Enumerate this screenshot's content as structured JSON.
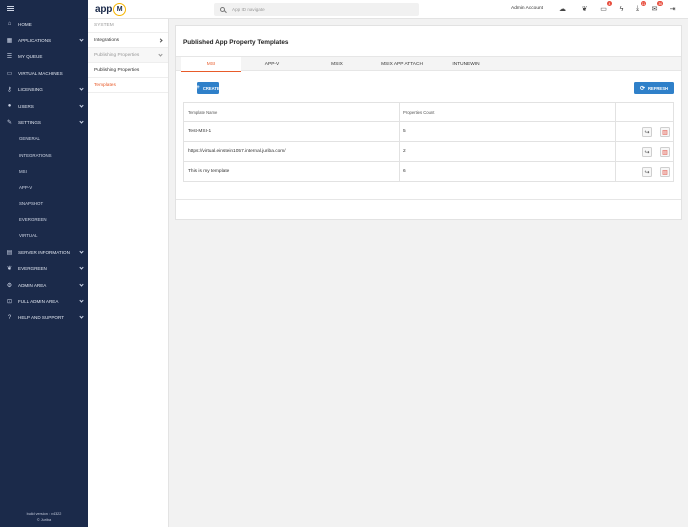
{
  "app": {
    "logo_text": "app",
    "logo_badge": "M"
  },
  "search": {
    "placeholder": "App ID navigate"
  },
  "topbar": {
    "admin_name": "Admin Account",
    "icons": [
      {
        "name": "cloud-icon",
        "badge": ""
      },
      {
        "name": "leaf-icon",
        "badge": ""
      },
      {
        "name": "monitor-icon",
        "badge": "4"
      },
      {
        "name": "bolt-icon",
        "badge": ""
      },
      {
        "name": "download-icon",
        "badge": "11"
      },
      {
        "name": "mail-icon",
        "badge": "36"
      },
      {
        "name": "logout-icon",
        "badge": ""
      }
    ]
  },
  "sidebar": {
    "items": [
      {
        "label": "Home",
        "icon": "home-icon",
        "chevron": false
      },
      {
        "label": "Applications",
        "icon": "apps-icon",
        "chevron": true
      },
      {
        "label": "My Queue",
        "icon": "queue-icon",
        "chevron": false
      },
      {
        "label": "Virtual Machines",
        "icon": "monitor-icon",
        "chevron": false
      },
      {
        "label": "Licensing",
        "icon": "key-icon",
        "chevron": true
      },
      {
        "label": "Users",
        "icon": "users-icon",
        "chevron": true
      },
      {
        "label": "Settings",
        "icon": "wrench-icon",
        "chevron": true
      }
    ],
    "settings_sub": [
      "General",
      "Integrations",
      "MSI",
      "App-V",
      "Snapshot",
      "Evergreen",
      "Virtual"
    ],
    "items_after": [
      {
        "label": "Server Information",
        "icon": "server-icon",
        "chevron": true
      },
      {
        "label": "Evergreen",
        "icon": "leaf-icon",
        "chevron": true
      },
      {
        "label": "Admin Area",
        "icon": "admin-icon",
        "chevron": true
      },
      {
        "label": "Full Admin Area",
        "icon": "full-admin-icon",
        "chevron": true
      },
      {
        "label": "Help and Support",
        "icon": "help-icon",
        "chevron": true
      }
    ],
    "footer_line1": "build version : v4322",
    "footer_line2": "© Juriba"
  },
  "subpanel": {
    "header": "System",
    "rows": [
      {
        "label": "Integrations",
        "style": "normal",
        "chevron": "right"
      },
      {
        "label": "Publishing Properties",
        "style": "muted",
        "chevron": "down"
      },
      {
        "label": "Publishing Properties",
        "style": "normal",
        "chevron": ""
      },
      {
        "label": "Templates",
        "style": "active",
        "chevron": ""
      }
    ]
  },
  "main": {
    "title": "Published App Property Templates",
    "tabs": [
      "MSI",
      "APP-V",
      "MSIX",
      "MSIX APP ATTACH",
      "INTUNEWIN"
    ],
    "active_tab": "MSI",
    "create_label": "Create",
    "refresh_label": "Refresh",
    "columns": [
      "Template Name",
      "Properties Count"
    ],
    "rows": [
      {
        "name": "Test-MSI-1",
        "count": "5"
      },
      {
        "name": "https://virtual.einstein1057.internal.juriba.com/",
        "count": "2"
      },
      {
        "name": "This is my template",
        "count": "6"
      }
    ]
  },
  "colors": {
    "sidebar_bg": "#1b2a4a",
    "accent": "#e85b2a",
    "primary_button": "#2f80c9",
    "badge": "#e74c3c"
  }
}
